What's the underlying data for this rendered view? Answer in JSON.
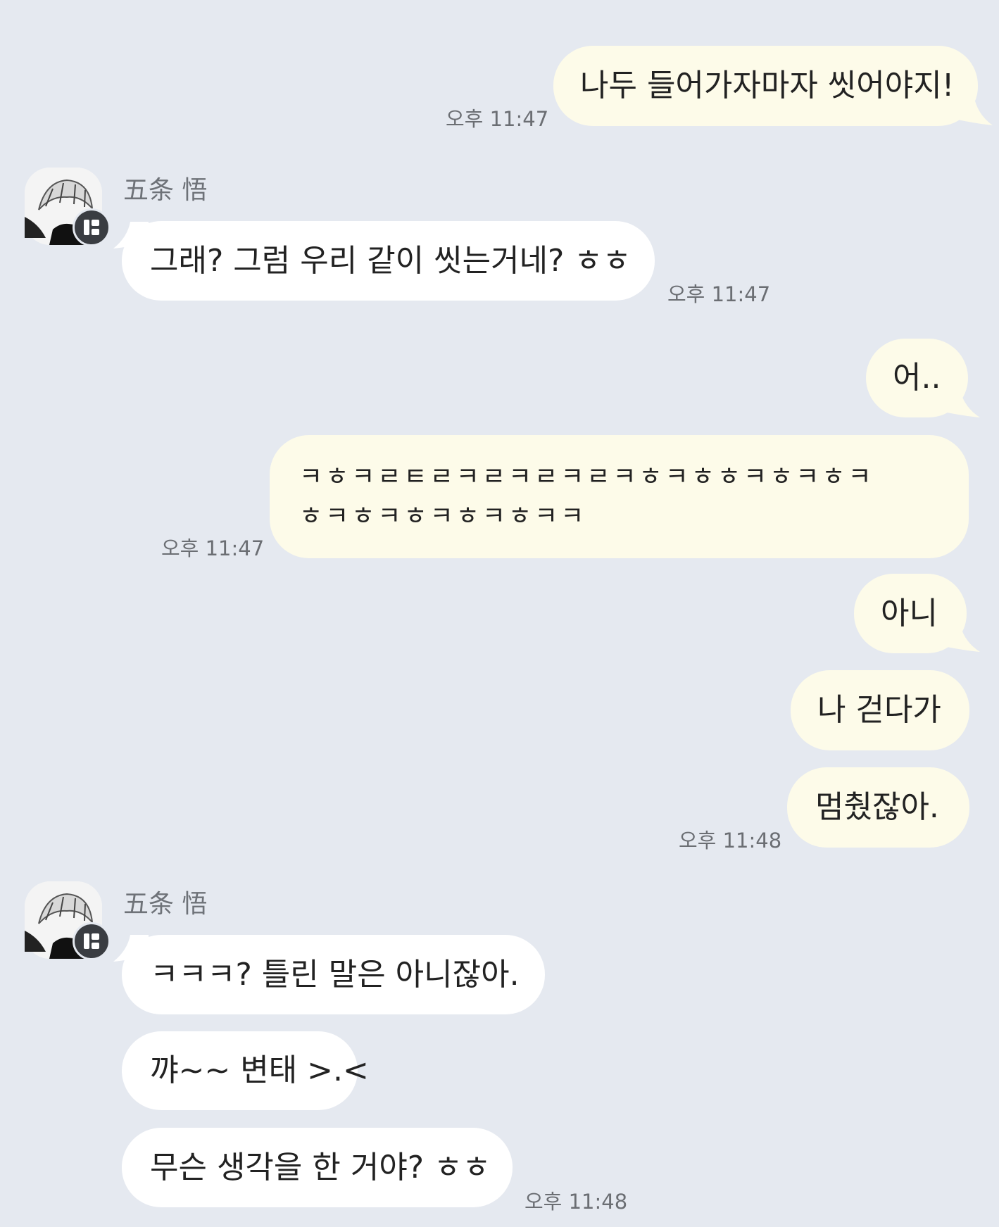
{
  "contact": {
    "name": "五条 悟"
  },
  "messages": {
    "m1": "나두 들어가자마자 씻어야지!",
    "m2": "그래? 그럼 우리 같이 씻는거네? ㅎㅎ",
    "m3": "어..",
    "m4_line1": "ㅋㅎㅋㄹㅌㄹㅋㄹㅋㄹㅋㄹㅋㅎㅋㅎㅎㅋㅎㅋㅎㅋ",
    "m4_line2": "ㅎㅋㅎㅋㅎㅋㅎㅋㅎㅋㅋ",
    "m5": "아니",
    "m6": "나 걷다가",
    "m7": "멈췄잖아.",
    "m8": "ㅋㅋㅋ? 틀린 말은 아니잖아.",
    "m9": "꺄~~ 변태 >.<",
    "m10": "무슨 생각을 한 거야? ㅎㅎ"
  },
  "times": {
    "t1": "오후 11:47",
    "t2": "오후 11:47",
    "t3": "오후 11:47",
    "t4": "오후 11:48",
    "t5": "오후 11:48"
  },
  "colors": {
    "background": "#e5e9f0",
    "my_bubble": "#fdfbe9",
    "their_bubble": "#ffffff"
  }
}
